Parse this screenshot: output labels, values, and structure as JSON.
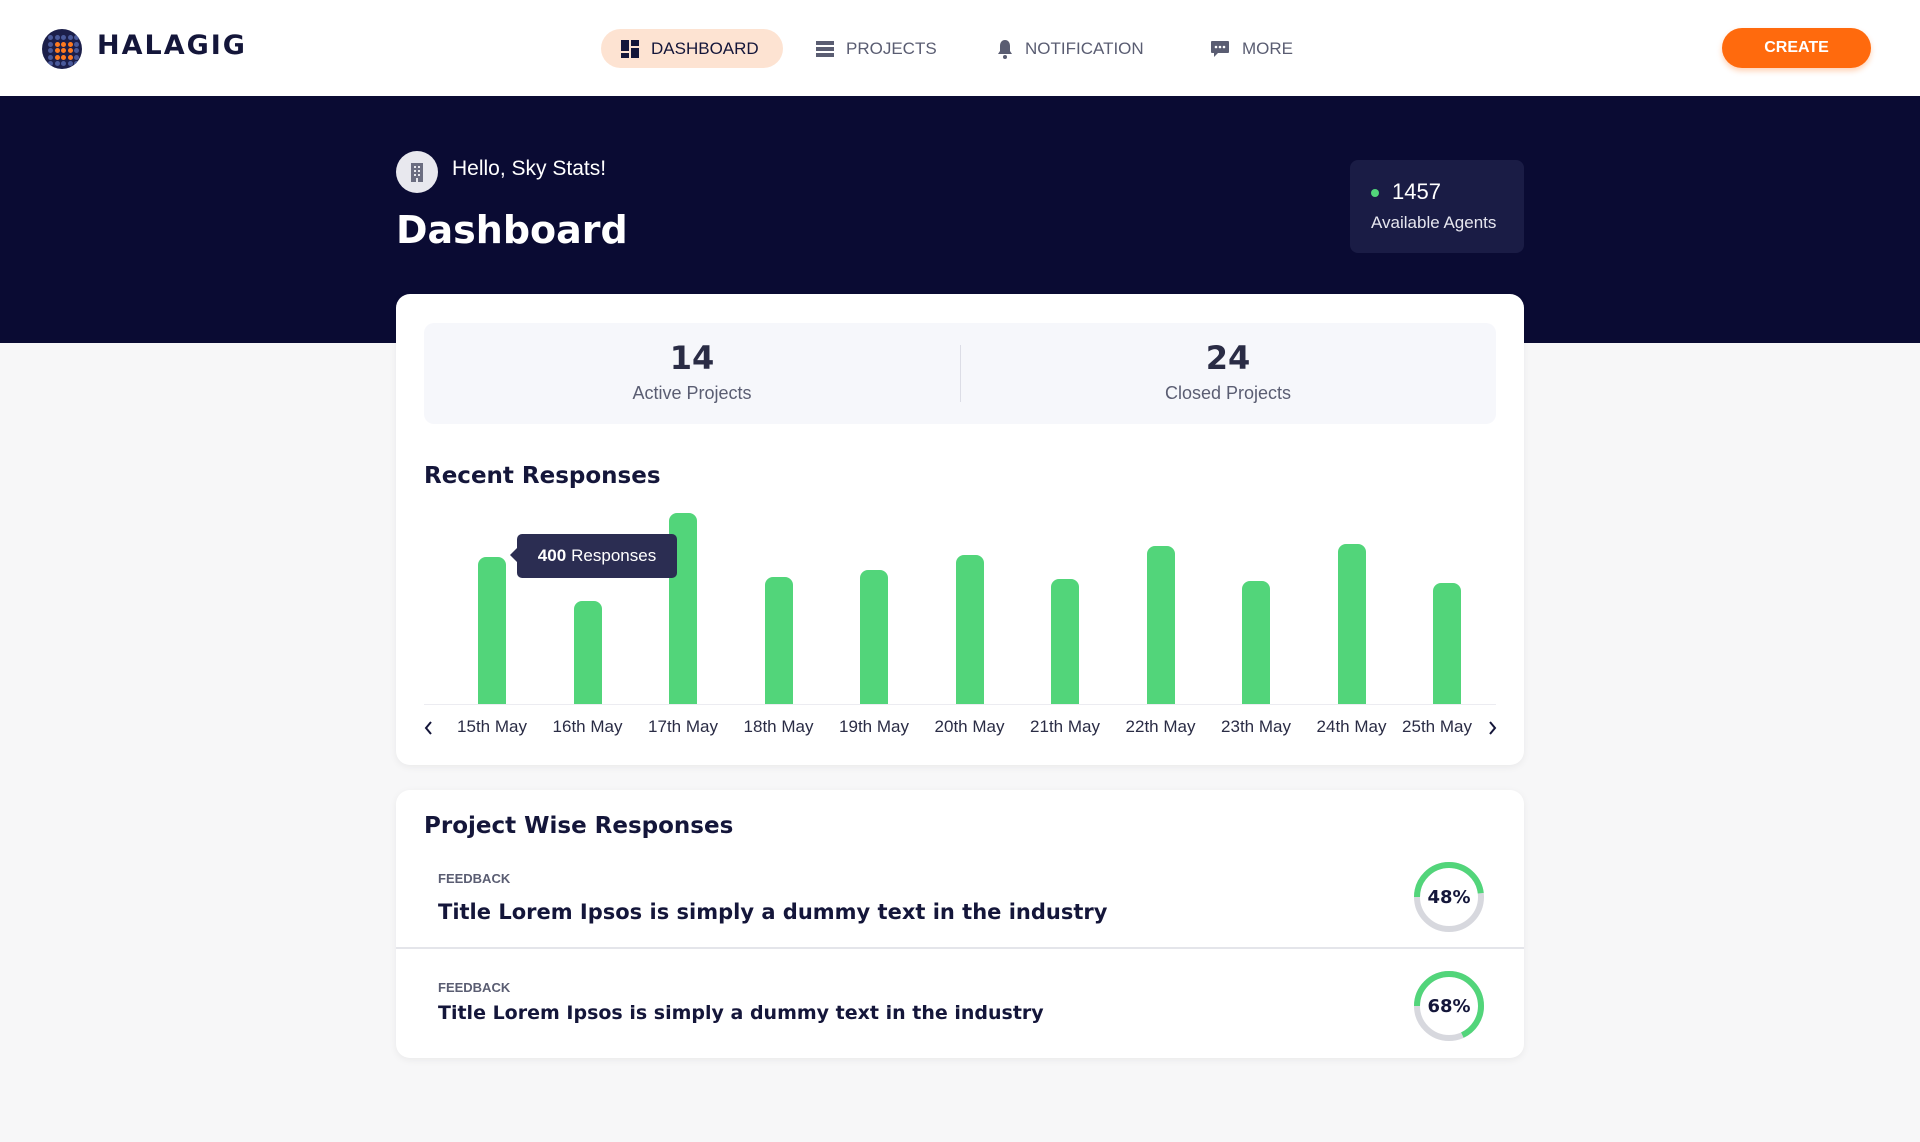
{
  "header": {
    "brand": "HALAGIG",
    "nav": [
      {
        "label": "DASHBOARD",
        "icon": "dashboard-icon",
        "active": true
      },
      {
        "label": "PROJECTS",
        "icon": "list-icon"
      },
      {
        "label": "NOTIFICATION",
        "icon": "bell-icon"
      },
      {
        "label": "MORE",
        "icon": "chat-icon"
      }
    ],
    "create_label": "CREATE"
  },
  "hero": {
    "greeting": "Hello, Sky Stats!",
    "title": "Dashboard",
    "agents_count": "1457",
    "agents_label": "Available Agents"
  },
  "stats": [
    {
      "value": "14",
      "label": "Active Projects"
    },
    {
      "value": "24",
      "label": "Closed Projects"
    }
  ],
  "recent": {
    "title": "Recent Responses",
    "tooltip_value": "400",
    "tooltip_label": "Responses"
  },
  "chart_data": {
    "type": "bar",
    "title": "Recent Responses",
    "categories": [
      "15th May",
      "16th May",
      "17th May",
      "18th May",
      "19th May",
      "20th May",
      "21th May",
      "22th May",
      "23th May",
      "24th May",
      "25th May"
    ],
    "values": [
      400,
      280,
      520,
      345,
      365,
      405,
      340,
      430,
      335,
      435,
      330
    ],
    "grid": false,
    "color": "#52d57a"
  },
  "project_wise": {
    "title": "Project Wise Responses",
    "items": [
      {
        "category": "FEEDBACK",
        "title": "Title Lorem Ipsos is simply a dummy text in the industry",
        "percent": 48,
        "percent_label": "48%"
      },
      {
        "category": "FEEDBACK",
        "title": "Title Lorem Ipsos is simply a dummy text in the industry",
        "percent": 68,
        "percent_label": "68%"
      }
    ]
  },
  "colors": {
    "accent": "#ff6a0d",
    "navy": "#0a0b33",
    "green": "#52d57a"
  }
}
